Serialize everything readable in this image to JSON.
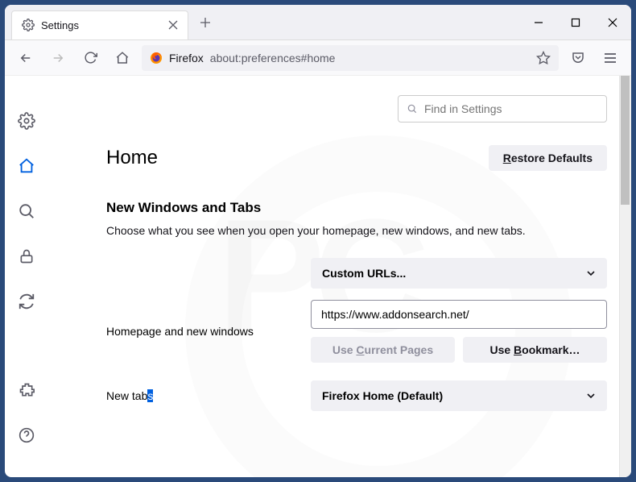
{
  "tab": {
    "title": "Settings"
  },
  "urlbar": {
    "label": "Firefox",
    "path": "about:preferences#home"
  },
  "search": {
    "placeholder": "Find in Settings"
  },
  "page": {
    "title": "Home",
    "restore": "Restore Defaults",
    "section_title": "New Windows and Tabs",
    "section_sub": "Choose what you see when you open your homepage, new windows, and new tabs."
  },
  "homepage": {
    "label": "Homepage and new windows",
    "dropdown": "Custom URLs...",
    "url": "https://www.addonsearch.net/",
    "use_current": "Use Current Pages",
    "use_bookmark": "Use Bookmark…"
  },
  "newtabs": {
    "label_prefix": "New tab",
    "label_hilite": "s",
    "dropdown": "Firefox Home (Default)"
  }
}
